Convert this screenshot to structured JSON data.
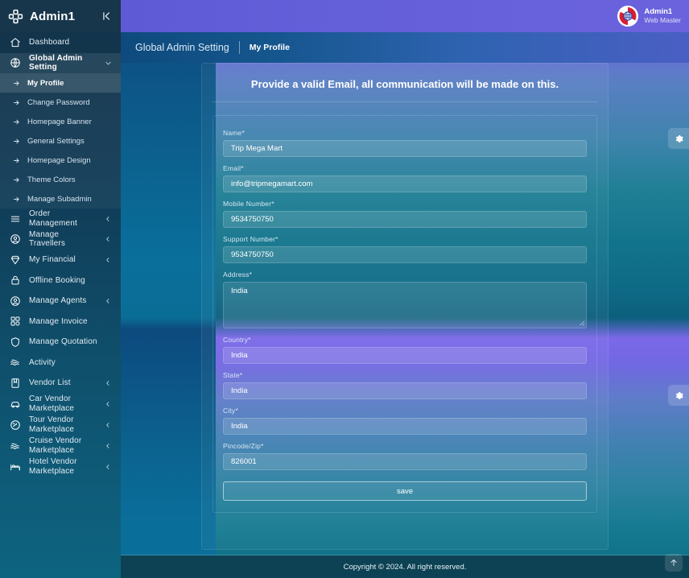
{
  "sidebar": {
    "brand": "Admin1",
    "collapse_icon": "collapse-left-icon",
    "items": [
      {
        "label": "Dashboard",
        "icon": "home-icon",
        "caret": false
      },
      {
        "label": "Global Admin Setting",
        "icon": "globe-icon",
        "caret": true,
        "caret_dir": "down",
        "active": true
      },
      {
        "label": "Order Management",
        "icon": "menu-lines-icon",
        "caret": true
      },
      {
        "label": "Manage Travellers",
        "icon": "user-circle-icon",
        "caret": true
      },
      {
        "label": "My Financial",
        "icon": "diamond-icon",
        "caret": true
      },
      {
        "label": "Offline Booking",
        "icon": "lock-icon",
        "caret": false
      },
      {
        "label": "Manage Agents",
        "icon": "user-circle-icon",
        "caret": true
      },
      {
        "label": "Manage Invoice",
        "icon": "grid-icon",
        "caret": false
      },
      {
        "label": "Manage Quotation",
        "icon": "shield-icon",
        "caret": false
      },
      {
        "label": "Activity",
        "icon": "waves-icon",
        "caret": false
      },
      {
        "label": "Vendor List",
        "icon": "bookmark-icon",
        "caret": true
      },
      {
        "label": "Car Vendor Marketplace",
        "icon": "car-icon",
        "caret": true
      },
      {
        "label": "Tour Vendor Marketplace",
        "icon": "globe-pin-icon",
        "caret": true
      },
      {
        "label": "Cruise Vendor Marketplace",
        "icon": "waves-icon",
        "caret": true
      },
      {
        "label": "Hotel Vendor Marketplace",
        "icon": "bed-icon",
        "caret": true
      }
    ],
    "submenu": [
      {
        "label": "My Profile",
        "selected": true
      },
      {
        "label": "Change Password",
        "selected": false
      },
      {
        "label": "Homepage Banner",
        "selected": false
      },
      {
        "label": "General Settings",
        "selected": false
      },
      {
        "label": "Homepage Design",
        "selected": false
      },
      {
        "label": "Theme Colors",
        "selected": false
      },
      {
        "label": "Manage Subadmin",
        "selected": false
      }
    ]
  },
  "topbar": {
    "user_name": "Admin1",
    "user_role": "Web Master",
    "avatar_icon": "globe-avatar-icon"
  },
  "breadcrumb": {
    "parent": "Global Admin Setting",
    "current": "My Profile"
  },
  "form": {
    "title": "Provide a valid Email, all communication will be made on this.",
    "fields": [
      {
        "label": "Name",
        "required": true,
        "value": "Trip Mega Mart",
        "type": "text",
        "name": "name-field"
      },
      {
        "label": "Email",
        "required": true,
        "value": "info@tripmegamart.com",
        "type": "text",
        "name": "email-field"
      },
      {
        "label": "Mobile Number",
        "required": true,
        "value": "9534750750",
        "type": "text",
        "name": "mobile-number-field"
      },
      {
        "label": "Support Number",
        "required": true,
        "value": "9534750750",
        "type": "text",
        "name": "support-number-field"
      },
      {
        "label": "Address",
        "required": true,
        "value": "India",
        "type": "textarea",
        "name": "address-field"
      },
      {
        "label": "Country",
        "required": true,
        "value": "India",
        "type": "text",
        "name": "country-field"
      },
      {
        "label": "State",
        "required": true,
        "value": "India",
        "type": "text",
        "name": "state-field"
      },
      {
        "label": "City",
        "required": true,
        "value": "India",
        "type": "text",
        "name": "city-field"
      },
      {
        "label": "Pincode/Zip",
        "required": true,
        "value": "826001",
        "type": "text",
        "name": "pincode-field"
      }
    ],
    "save_label": "save"
  },
  "floating": {
    "gear_icon": "gear-icon",
    "scroll_top_icon": "arrow-up-icon"
  },
  "footer": {
    "text": "Copyright © 2024. All right reserved."
  },
  "colors": {
    "topbar": "#6460da",
    "sidebar": "#123349",
    "footer": "#0d4254",
    "accent_purple": "#7b68e8",
    "accent_teal": "#0a6f9b"
  }
}
